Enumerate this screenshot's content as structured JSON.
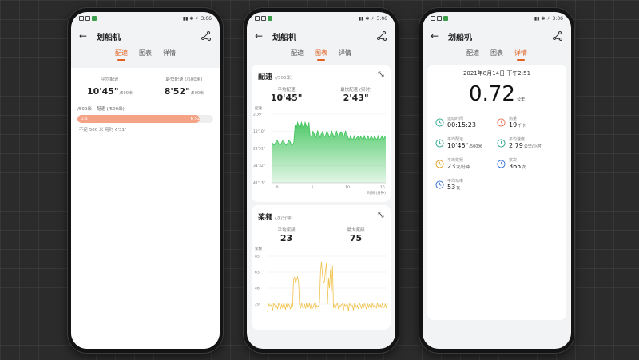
{
  "status_bar": {
    "time": "3:06"
  },
  "app_title": "划船机",
  "tabs": [
    "配速",
    "图表",
    "详情"
  ],
  "phone1": {
    "avg_pace": {
      "label": "平均配速",
      "value": "10'45\"",
      "unit": "/500米"
    },
    "best_pace": {
      "label": "最快配速 (/500米)",
      "value": "8'52\"",
      "unit": "/500米"
    },
    "section_unit": "/500米",
    "section_title": "配速 (/500米)",
    "bar": {
      "left": "0.5",
      "right": "6'52\"",
      "fill_fraction": 0.9
    },
    "note": "不足 500 米 用时 6'31\""
  },
  "phone2": {
    "pace_card": {
      "title": "配速",
      "unit": "(/500米)",
      "avg_label": "平均配速",
      "avg_value": "10'45\"",
      "best_label": "最快配速 (实时)",
      "best_value": "2'43\"",
      "y_axis_label": "配速",
      "y_ticks": [
        "2'39\"",
        "12'10\"",
        "21'51\"",
        "31'32\"",
        "41'13\""
      ],
      "x_ticks": [
        "0",
        "5",
        "10",
        "15"
      ],
      "x_axis_label": "时间 (分钟)",
      "color": "#3ec45a"
    },
    "stroke_card": {
      "title": "桨频",
      "unit": "(次/分钟)",
      "avg_label": "平均桨频",
      "avg_value": "23",
      "max_label": "最大桨频",
      "max_value": "75",
      "y_axis_label": "桨频",
      "y_ticks": [
        "85",
        "63",
        "46",
        "29"
      ],
      "color": "#f0c24a"
    }
  },
  "phone3": {
    "datetime": "2021年8月14日 下午2:51",
    "distance": "0.72",
    "distance_unit": "公里",
    "metrics": [
      {
        "icon": "clock-icon",
        "label": "运动时间",
        "value": "00:15:23",
        "unit": ""
      },
      {
        "icon": "flame-icon",
        "label": "热量",
        "value": "19",
        "unit": "千卡"
      },
      {
        "icon": "speedometer-icon",
        "label": "平均配速",
        "value": "10'45\"",
        "unit": "/500米"
      },
      {
        "icon": "speed-gauge-icon",
        "label": "平均速度",
        "value": "2.79",
        "unit": "公里/小时"
      },
      {
        "icon": "paddle-icon",
        "label": "平均桨频",
        "value": "23",
        "unit": "次/分钟"
      },
      {
        "icon": "stroke-count-icon",
        "label": "桨次",
        "value": "365",
        "unit": "次"
      },
      {
        "icon": "power-icon",
        "label": "平均功率",
        "value": "53",
        "unit": "瓦"
      }
    ]
  }
}
